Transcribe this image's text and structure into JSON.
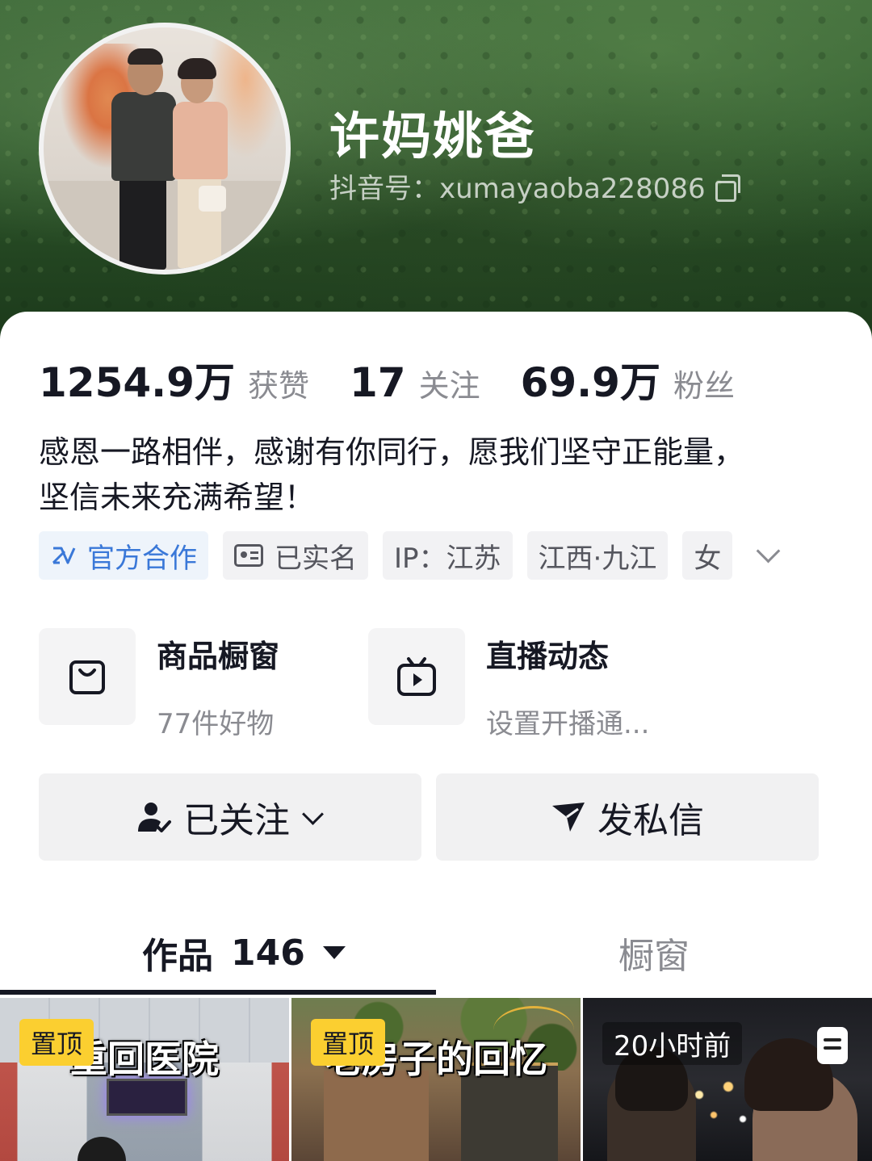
{
  "profile": {
    "nickname": "许妈姚爸",
    "douyin_id": "抖音号：xumayaoba228086"
  },
  "stats": [
    {
      "value": "1254.9万",
      "label": "获赞"
    },
    {
      "value": "17",
      "label": "关注"
    },
    {
      "value": "69.9万",
      "label": "粉丝"
    }
  ],
  "bio": {
    "line1": "感恩一路相伴，感谢有你同行，愿我们坚守正能量，",
    "line2": "坚信未来充满希望！"
  },
  "tags": {
    "official": "官方合作",
    "verified": "已实名",
    "ip": "IP：江苏",
    "location": "江西·九江",
    "gender": "女"
  },
  "features": {
    "shop": {
      "title": "商品橱窗",
      "sub": "77件好物"
    },
    "live": {
      "title": "直播动态",
      "sub": "设置开播通..."
    }
  },
  "actions": {
    "follow": "已关注",
    "message": "发私信"
  },
  "tabs": {
    "works_label": "作品",
    "works_count": "146",
    "shop_label": "橱窗"
  },
  "videos": [
    {
      "badge": "置顶",
      "title": "重回医院"
    },
    {
      "badge": "置顶",
      "title": "老房子的回忆"
    },
    {
      "time": "20小时前"
    }
  ],
  "colors": {
    "accent_blue": "#3a78d8",
    "pin_yellow": "#fbcf30",
    "header_green": "#2f5a2d"
  }
}
